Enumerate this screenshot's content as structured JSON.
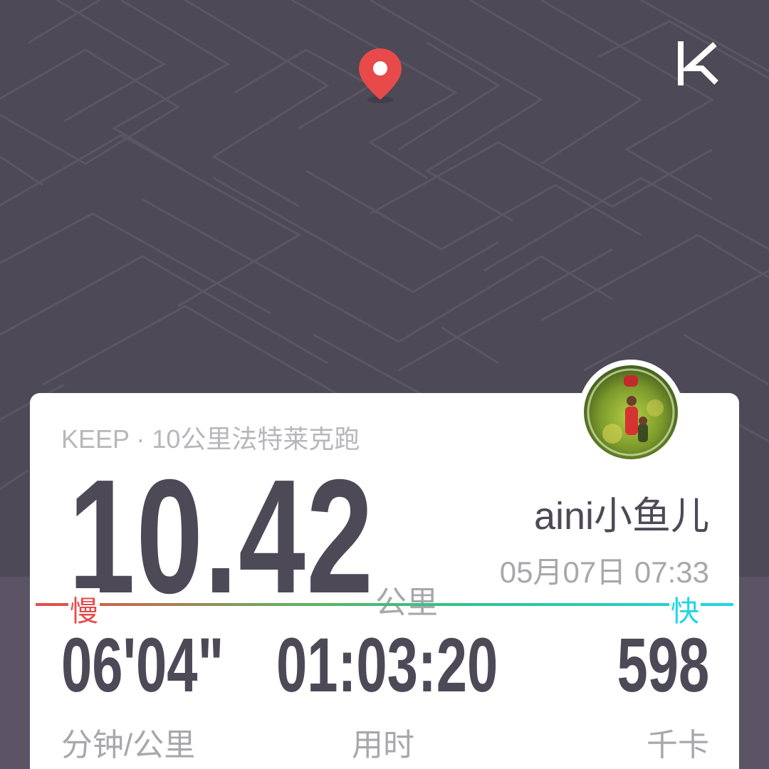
{
  "header": {
    "logo_icon": "keep-logo-icon",
    "location_icon": "location-pin-icon"
  },
  "card": {
    "event_title": "KEEP · 10公里法特莱克跑",
    "distance": "10.42",
    "distance_unit": "公里",
    "username": "aini小鱼儿",
    "datetime": "05月07日 07:33",
    "pace_bar": {
      "slow_label": "慢",
      "fast_label": "快",
      "colors": [
        "#e84a4a",
        "#5fb25e",
        "#1fd6e6"
      ]
    },
    "stats": [
      {
        "value": "06'04\"",
        "label": "分钟/公里"
      },
      {
        "value": "01:03:20",
        "label": "用时"
      },
      {
        "value": "598",
        "label": "千卡"
      }
    ]
  },
  "colors": {
    "map_background": "#4d4956",
    "primary_text": "#4d4956",
    "secondary_text": "#a8a8ac",
    "pin": "#e84a4a"
  }
}
